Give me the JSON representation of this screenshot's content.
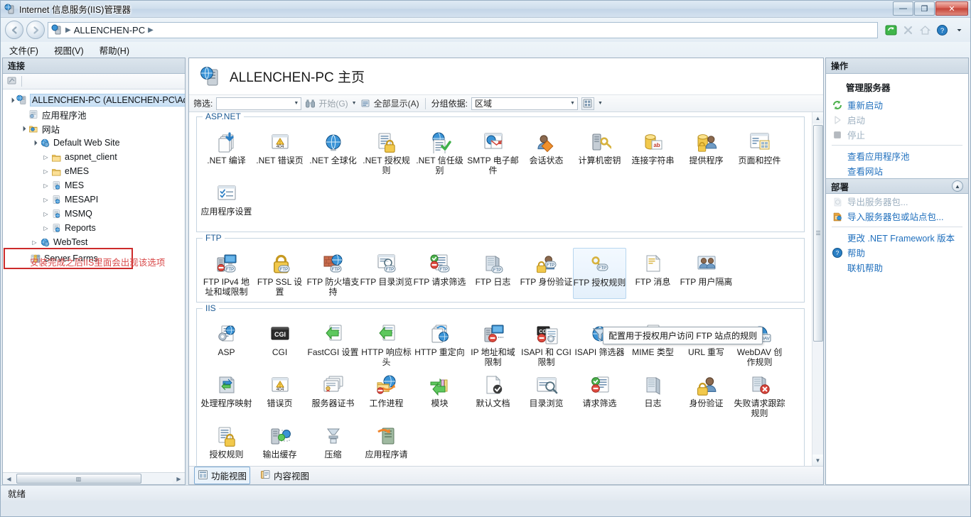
{
  "window": {
    "title": "Internet 信息服务(IIS)管理器",
    "icon": "iis-server-icon",
    "minimize": "—",
    "maximize": "❐",
    "close": "✕"
  },
  "address": {
    "back_icon": "back-arrow-icon",
    "forward_icon": "forward-arrow-icon",
    "crumb_icon": "server-icon",
    "path": "ALLENCHEN-PC",
    "separator": "▶",
    "tools": [
      "refresh-icon",
      "stop-icon",
      "home-icon",
      "help-icon",
      "dropdown-caret-icon"
    ]
  },
  "menu": {
    "items": [
      {
        "label": "文件(F)",
        "name": "menu-file"
      },
      {
        "label": "视图(V)",
        "name": "menu-view"
      },
      {
        "label": "帮助(H)",
        "name": "menu-help"
      }
    ]
  },
  "connections": {
    "header": "连接",
    "toolbar_icons": [
      "connect-icon"
    ],
    "tree": [
      {
        "label": "ALLENCHEN-PC (ALLENCHEN-PC\\Ad",
        "depth": 0,
        "twist": "▲",
        "icon": "server-icon",
        "selected": true,
        "boxed": false
      },
      {
        "label": "应用程序池",
        "depth": 1,
        "twist": "",
        "icon": "app-pool-icon",
        "selected": false,
        "boxed": false
      },
      {
        "label": "网站",
        "depth": 1,
        "twist": "▲",
        "icon": "sites-folder-icon",
        "selected": false,
        "boxed": false
      },
      {
        "label": "Default Web Site",
        "depth": 2,
        "twist": "▲",
        "icon": "website-icon",
        "selected": false,
        "boxed": false
      },
      {
        "label": "aspnet_client",
        "depth": 3,
        "twist": "▷",
        "icon": "folder-icon",
        "selected": false,
        "boxed": false
      },
      {
        "label": "eMES",
        "depth": 3,
        "twist": "▷",
        "icon": "folder-icon",
        "selected": false,
        "boxed": false
      },
      {
        "label": "MES",
        "depth": 3,
        "twist": "▷",
        "icon": "application-icon",
        "selected": false,
        "boxed": false
      },
      {
        "label": "MESAPI",
        "depth": 3,
        "twist": "▷",
        "icon": "application-icon",
        "selected": false,
        "boxed": false
      },
      {
        "label": "MSMQ",
        "depth": 3,
        "twist": "▷",
        "icon": "application-icon",
        "selected": false,
        "boxed": false
      },
      {
        "label": "Reports",
        "depth": 3,
        "twist": "▷",
        "icon": "application-icon",
        "selected": false,
        "boxed": false
      },
      {
        "label": "WebTest",
        "depth": 2,
        "twist": "▷",
        "icon": "website-icon",
        "selected": false,
        "boxed": false
      },
      {
        "label": "Server Farms",
        "depth": 1,
        "twist": "",
        "icon": "server-farm-icon",
        "selected": false,
        "boxed": true
      }
    ],
    "annotation": "安装完成之后IIS里面会出现该选项",
    "annotation_color": "#d94a4a",
    "highlight_box_color": "#cc2b2b",
    "hscroll_thumb": "▥"
  },
  "main": {
    "page_icon": "server-home-icon",
    "page_title": "ALLENCHEN-PC 主页",
    "filter": {
      "label": "筛选:",
      "value": "",
      "placeholder": "",
      "go_label": "开始(G)",
      "go_icon": "binoculars-icon",
      "showall_label": "全部显示(A)",
      "showall_icon": "show-all-icon",
      "groupby_label": "分组依据:",
      "groupby_value": "区域",
      "view_icon": "view-mode-icon"
    },
    "groups": [
      {
        "name": "ASP.NET",
        "items": [
          {
            "label": ".NET 编译",
            "icon": "net-compile-icon",
            "selected": false
          },
          {
            "label": ".NET 错误页",
            "icon": "net-error-pages-icon",
            "selected": false
          },
          {
            "label": ".NET 全球化",
            "icon": "net-globalization-icon",
            "selected": false
          },
          {
            "label": ".NET 授权规则",
            "icon": "net-authorization-rules-icon",
            "selected": false
          },
          {
            "label": ".NET 信任级别",
            "icon": "net-trust-levels-icon",
            "selected": false
          },
          {
            "label": "SMTP 电子邮件",
            "icon": "smtp-email-icon",
            "selected": false
          },
          {
            "label": "会话状态",
            "icon": "session-state-icon",
            "selected": false
          },
          {
            "label": "计算机密钥",
            "icon": "machine-key-icon",
            "selected": false
          },
          {
            "label": "连接字符串",
            "icon": "connection-strings-icon",
            "selected": false
          },
          {
            "label": "提供程序",
            "icon": "providers-icon",
            "selected": false
          },
          {
            "label": "页面和控件",
            "icon": "pages-and-controls-icon",
            "selected": false
          },
          {
            "label": "应用程序设置",
            "icon": "application-settings-icon",
            "selected": false
          }
        ]
      },
      {
        "name": "FTP",
        "items": [
          {
            "label": "FTP IPv4 地址和域限制",
            "icon": "ftp-ipv4-restrictions-icon",
            "selected": false
          },
          {
            "label": "FTP SSL 设置",
            "icon": "ftp-ssl-settings-icon",
            "selected": false
          },
          {
            "label": "FTP 防火墙支持",
            "icon": "ftp-firewall-support-icon",
            "selected": false
          },
          {
            "label": "FTP 目录浏览",
            "icon": "ftp-directory-browsing-icon",
            "selected": false
          },
          {
            "label": "FTP 请求筛选",
            "icon": "ftp-request-filtering-icon",
            "selected": false
          },
          {
            "label": "FTP 日志",
            "icon": "ftp-logging-icon",
            "selected": false
          },
          {
            "label": "FTP 身份验证",
            "icon": "ftp-authentication-icon",
            "selected": false
          },
          {
            "label": "FTP 授权规则",
            "icon": "ftp-authorization-rules-icon",
            "selected": true
          },
          {
            "label": "FTP 消息",
            "icon": "ftp-messages-icon",
            "selected": false
          },
          {
            "label": "FTP 用户隔离",
            "icon": "ftp-user-isolation-icon",
            "selected": false
          }
        ]
      },
      {
        "name": "IIS",
        "items": [
          {
            "label": "ASP",
            "icon": "asp-icon",
            "selected": false
          },
          {
            "label": "CGI",
            "icon": "cgi-icon",
            "selected": false
          },
          {
            "label": "FastCGI 设置",
            "icon": "fastcgi-settings-icon",
            "selected": false
          },
          {
            "label": "HTTP 响应标头",
            "icon": "http-response-headers-icon",
            "selected": false
          },
          {
            "label": "HTTP 重定向",
            "icon": "http-redirect-icon",
            "selected": false
          },
          {
            "label": "IP 地址和域限制",
            "icon": "ip-address-restrictions-icon",
            "selected": false
          },
          {
            "label": "ISAPI 和 CGI 限制",
            "icon": "isapi-cgi-restrictions-icon",
            "selected": false
          },
          {
            "label": "ISAPI 筛选器",
            "icon": "isapi-filters-icon",
            "selected": false
          },
          {
            "label": "MIME 类型",
            "icon": "mime-types-icon",
            "selected": false
          },
          {
            "label": "URL 重写",
            "icon": "url-rewrite-icon",
            "selected": false
          },
          {
            "label": "WebDAV 创作规则",
            "icon": "webdav-authoring-rules-icon",
            "selected": false
          },
          {
            "label": "处理程序映射",
            "icon": "handler-mappings-icon",
            "selected": false
          },
          {
            "label": "错误页",
            "icon": "error-pages-icon",
            "selected": false
          },
          {
            "label": "服务器证书",
            "icon": "server-certificates-icon",
            "selected": false
          },
          {
            "label": "工作进程",
            "icon": "worker-processes-icon",
            "selected": false
          },
          {
            "label": "模块",
            "icon": "modules-icon",
            "selected": false
          },
          {
            "label": "默认文档",
            "icon": "default-document-icon",
            "selected": false
          },
          {
            "label": "目录浏览",
            "icon": "directory-browsing-icon",
            "selected": false
          },
          {
            "label": "请求筛选",
            "icon": "request-filtering-icon",
            "selected": false
          },
          {
            "label": "日志",
            "icon": "logging-icon",
            "selected": false
          },
          {
            "label": "身份验证",
            "icon": "authentication-icon",
            "selected": false
          },
          {
            "label": "失败请求跟踪规则",
            "icon": "failed-request-tracing-icon",
            "selected": false
          },
          {
            "label": "授权规则",
            "icon": "authorization-rules-icon",
            "selected": false
          },
          {
            "label": "输出缓存",
            "icon": "output-caching-icon",
            "selected": false
          },
          {
            "label": "压缩",
            "icon": "compression-icon",
            "selected": false
          },
          {
            "label": "应用程序请",
            "icon": "application-request-routing-icon",
            "selected": false
          }
        ]
      }
    ],
    "tooltip": "配置用于授权用户访问 FTP 站点的规则",
    "view_tabs": [
      {
        "label": "功能视图",
        "icon": "features-view-icon",
        "active": true
      },
      {
        "label": "内容视图",
        "icon": "content-view-icon",
        "active": false
      }
    ]
  },
  "actions": {
    "header": "操作",
    "sections": [
      {
        "title": "管理服务器",
        "collapsible": false,
        "items": [
          {
            "label": "重新启动",
            "icon": "restart-icon",
            "disabled": false
          },
          {
            "label": "启动",
            "icon": "start-icon",
            "disabled": true
          },
          {
            "label": "停止",
            "icon": "stop-icon",
            "disabled": true
          },
          {
            "divider": true
          },
          {
            "label": "查看应用程序池",
            "icon": "",
            "disabled": false
          },
          {
            "label": "查看网站",
            "icon": "",
            "disabled": false
          }
        ]
      },
      {
        "title": "部署",
        "collapsible": true,
        "collapse_icon": "▲",
        "items": [
          {
            "label": "导出服务器包...",
            "icon": "export-package-icon",
            "disabled": true
          },
          {
            "label": "导入服务器包或站点包...",
            "icon": "import-package-icon",
            "disabled": false
          },
          {
            "divider": true
          },
          {
            "label": "更改 .NET Framework 版本",
            "icon": "",
            "disabled": false
          },
          {
            "label": "帮助",
            "icon": "help-icon",
            "disabled": false
          },
          {
            "label": "联机帮助",
            "icon": "",
            "disabled": false
          }
        ]
      }
    ]
  },
  "status": {
    "text": "就绪"
  },
  "colors": {
    "link": "#1f6fbd",
    "group_label": "#1c5a94",
    "annotation": "#d94a4a",
    "selection": "#cde2f5"
  }
}
